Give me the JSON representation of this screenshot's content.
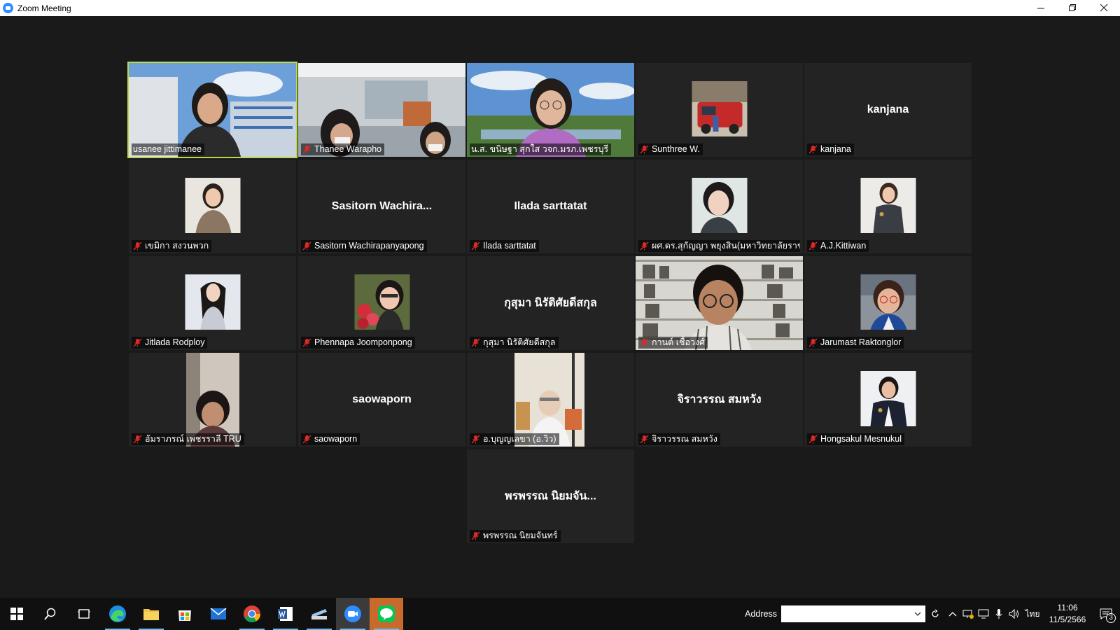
{
  "window": {
    "title": "Zoom Meeting",
    "controls": [
      "minimize",
      "restore",
      "close"
    ]
  },
  "participants": [
    {
      "name": "usanee jittimanee",
      "display": "video",
      "muted": false,
      "speaking": true
    },
    {
      "name": "Thanee Warapho",
      "display": "video",
      "muted": true
    },
    {
      "name": "น.ส. ขนิษฐา สุกใส วจก.มรภ.เพชรบุรี",
      "display": "video",
      "muted": false
    },
    {
      "name": "Sunthree W.",
      "display": "photo",
      "muted": true
    },
    {
      "name": "kanjana",
      "display": "name",
      "center_text": "kanjana",
      "muted": true
    },
    {
      "name": "เขมิกา สงวนพวก",
      "display": "photo",
      "muted": true
    },
    {
      "name": "Sasitorn Wachirapanyapong",
      "display": "name",
      "center_text": "Sasitorn  Wachira...",
      "muted": true
    },
    {
      "name": "Ilada sarttatat",
      "display": "name",
      "center_text": "Ilada sarttatat",
      "muted": true
    },
    {
      "name": "ผศ.ดร.สุกัญญา พยุงสิน(มหาวิทยาลัยราช...",
      "display": "photo",
      "muted": true
    },
    {
      "name": "A.J.Kittiwan",
      "display": "photo",
      "muted": true
    },
    {
      "name": "Jitlada Rodploy",
      "display": "photo",
      "muted": true
    },
    {
      "name": "Phennapa Joomponpong",
      "display": "photo",
      "muted": true
    },
    {
      "name": "กุสุมา นิรัติศัยดีสกุล",
      "display": "name",
      "center_text": "กุสุมา นิรัติศัยดีสกุล",
      "muted": true
    },
    {
      "name": "กานต์ เชื้อวงศ์",
      "display": "video",
      "muted": true
    },
    {
      "name": "Jarumast Raktonglor",
      "display": "photo",
      "muted": true
    },
    {
      "name": "อัมราภรณ์ เพชรราลี TRU",
      "display": "video",
      "muted": true
    },
    {
      "name": "saowaporn",
      "display": "name",
      "center_text": "saowaporn",
      "muted": true
    },
    {
      "name": "อ.บุญญเลขา (อ.วิว)",
      "display": "video",
      "muted": true
    },
    {
      "name": "จิราวรรณ สมหวัง",
      "display": "name",
      "center_text": "จิราวรรณ สมหวัง",
      "muted": true
    },
    {
      "name": "Hongsakul Mesnukul",
      "display": "photo",
      "muted": true
    },
    {
      "name": "พรพรรณ  นิยมจันทร์",
      "display": "name",
      "center_text": "พรพรรณ  นิยมจัน...",
      "muted": true
    }
  ],
  "taskbar": {
    "apps": [
      "start-icon",
      "search-icon",
      "task-view-icon",
      "edge-icon",
      "file-explorer-icon",
      "store-icon",
      "mail-icon",
      "chrome-icon",
      "word-icon",
      "scanner-icon",
      "zoom-icon",
      "line-icon"
    ],
    "address_label": "Address",
    "address_value": "",
    "language": "ไทย",
    "time": "11:06",
    "date": "11/5/2566",
    "notification_count": "3"
  },
  "colors": {
    "background": "#1a1a1a",
    "tile": "#232323",
    "active_speaker_border": "#b9d94b",
    "mute_red": "#e02828",
    "taskbar": "#101010"
  }
}
